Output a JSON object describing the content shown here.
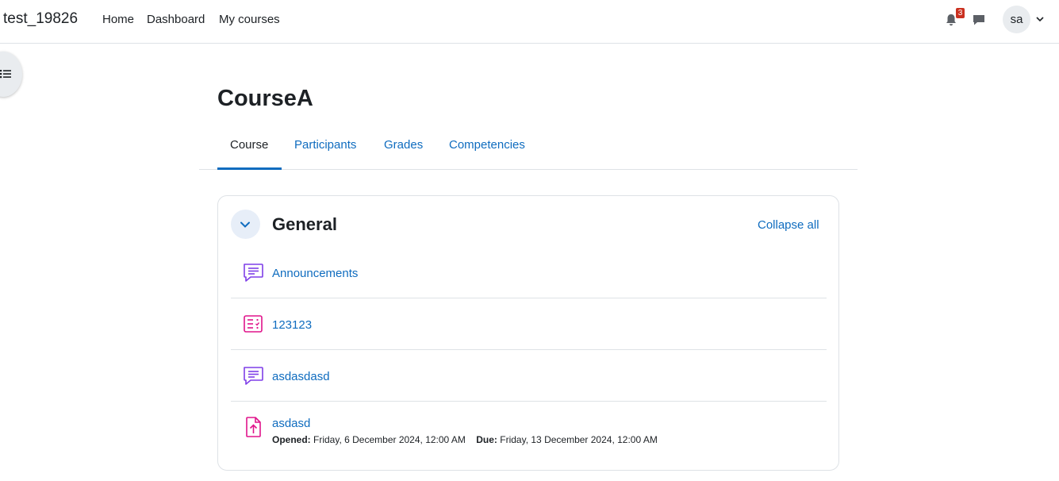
{
  "navbar": {
    "brand": "test_19826",
    "links": [
      "Home",
      "Dashboard",
      "My courses"
    ],
    "notification_count": "3",
    "user_initials": "sa"
  },
  "course": {
    "title": "CourseA",
    "tabs": [
      {
        "label": "Course",
        "active": true
      },
      {
        "label": "Participants",
        "active": false
      },
      {
        "label": "Grades",
        "active": false
      },
      {
        "label": "Competencies",
        "active": false
      }
    ]
  },
  "section": {
    "title": "General",
    "collapse_all_label": "Collapse all",
    "activities": [
      {
        "name": "Announcements",
        "icon": "forum-icon"
      },
      {
        "name": "123123",
        "icon": "quiz-icon"
      },
      {
        "name": "asdasdasd",
        "icon": "forum-icon"
      },
      {
        "name": "asdasd",
        "icon": "assignment-icon",
        "opened_label": "Opened:",
        "opened_value": "Friday, 6 December 2024, 12:00 AM",
        "due_label": "Due:",
        "due_value": "Friday, 13 December 2024, 12:00 AM"
      }
    ]
  },
  "colors": {
    "link": "#0f6cbf",
    "forum_icon": "#7f3fe8",
    "quiz_icon": "#e0148b",
    "assignment_icon": "#e0148b",
    "badge": "#ca3120"
  }
}
